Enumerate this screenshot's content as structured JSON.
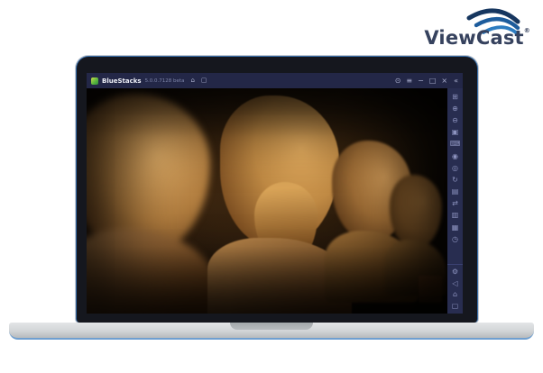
{
  "brand": {
    "name": "ViewCast",
    "registered_mark": "®",
    "logo_text_color": "#36425e",
    "swoosh_colors": [
      "#16365f",
      "#1d5c9c",
      "#2d7cc0"
    ]
  },
  "colors": {
    "page_background": "#ffffff",
    "bezel": "#15171e",
    "rim_accent_blue": "#386ea9",
    "titlebar_bg": "#232747",
    "sidebar_bg": "#282d50",
    "base_gray": "#d2d5d7",
    "photo_warm_tone": "#c08a44"
  },
  "window": {
    "title": "BlueStacks",
    "version": "5.0.0.7128 beta",
    "tab_icons": [
      {
        "name": "home-tab-icon",
        "glyph": "⌂"
      },
      {
        "name": "app-tab-icon",
        "glyph": "▢"
      }
    ],
    "controls": [
      {
        "name": "boost-icon",
        "glyph": "⊙"
      },
      {
        "name": "menu-icon",
        "glyph": "≡"
      },
      {
        "name": "minimize-icon",
        "glyph": "−"
      },
      {
        "name": "maximize-icon",
        "glyph": "□"
      },
      {
        "name": "close-icon",
        "glyph": "×"
      },
      {
        "name": "collapse-sidebar-icon",
        "glyph": "«"
      }
    ]
  },
  "sidebar": {
    "items": [
      {
        "name": "fullscreen-icon",
        "glyph": "⊞"
      },
      {
        "name": "zoom-in-icon",
        "glyph": "⊕"
      },
      {
        "name": "zoom-out-icon",
        "glyph": "⊖"
      },
      {
        "name": "screenshot-icon",
        "glyph": "▣"
      },
      {
        "name": "keyboard-controls-icon",
        "glyph": "⌨"
      },
      {
        "name": "screen-record-icon",
        "glyph": "◉"
      },
      {
        "name": "macro-recorder-icon",
        "glyph": "◎"
      },
      {
        "name": "rotate-icon",
        "glyph": "↻"
      },
      {
        "name": "install-apk-icon",
        "glyph": "▤"
      },
      {
        "name": "shake-icon",
        "glyph": "⇄"
      },
      {
        "name": "media-manager-icon",
        "glyph": "▥"
      },
      {
        "name": "multi-instance-icon",
        "glyph": "▦"
      },
      {
        "name": "history-icon",
        "glyph": "◷"
      }
    ],
    "bottom_items": [
      {
        "name": "settings-icon",
        "glyph": "⚙"
      },
      {
        "name": "back-icon",
        "glyph": "◁"
      },
      {
        "name": "home-icon",
        "glyph": "⌂"
      },
      {
        "name": "recent-apps-icon",
        "glyph": "▢"
      }
    ]
  },
  "screen_content": {
    "type": "photo",
    "subject": "Four ancient philosopher marble busts in a row, receding to the right",
    "lighting": "warm amber spotlight on dark museum background"
  }
}
